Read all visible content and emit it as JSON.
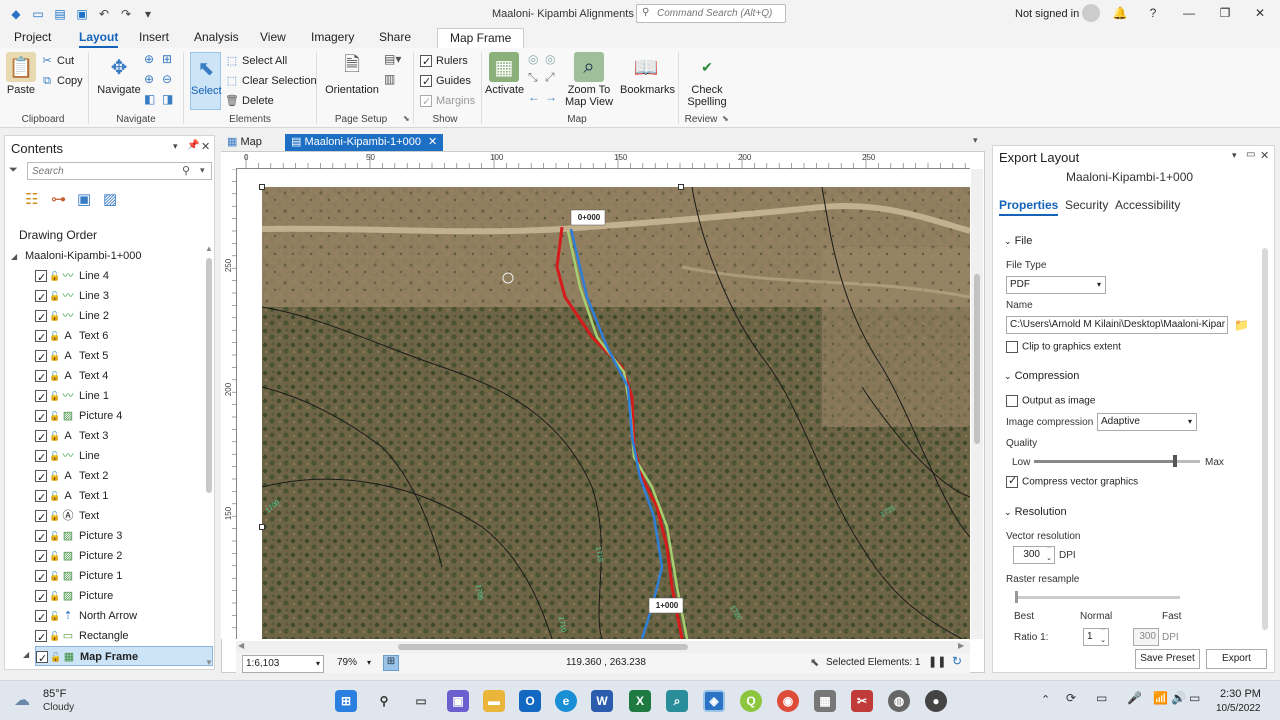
{
  "window": {
    "title": "Maaloni- Kipambi Alignments",
    "command_search_placeholder": "Command Search (Alt+Q)",
    "sign_in": "Not signed in"
  },
  "ribbon_tabs": [
    "Project",
    "Layout",
    "Insert",
    "Analysis",
    "View",
    "Imagery",
    "Share",
    "Map Frame"
  ],
  "ribbon": {
    "clipboard": {
      "paste": "Paste",
      "cut": "Cut",
      "copy": "Copy",
      "label": "Clipboard"
    },
    "navigate": {
      "navigate": "Navigate",
      "label": "Navigate"
    },
    "elements": {
      "select": "Select",
      "select_all": "Select All",
      "clear_selection": "Clear Selection",
      "delete": "Delete",
      "label": "Elements"
    },
    "page_setup": {
      "orientation": "Orientation",
      "label": "Page Setup"
    },
    "show": {
      "rulers": "Rulers",
      "guides": "Guides",
      "margins": "Margins",
      "label": "Show"
    },
    "map": {
      "activate": "Activate",
      "zoom_to_map_view": "Zoom To Map View",
      "bookmarks": "Bookmarks",
      "label": "Map"
    },
    "review": {
      "check_spelling": "Check Spelling",
      "label": "Review"
    }
  },
  "contents": {
    "title": "Contents",
    "search_placeholder": "Search",
    "drawing_order": "Drawing Order",
    "root": "Maaloni-Kipambi-1+000",
    "items": [
      {
        "label": "Line 4",
        "icon": "line-icon"
      },
      {
        "label": "Line 3",
        "icon": "line-icon"
      },
      {
        "label": "Line 2",
        "icon": "line-icon"
      },
      {
        "label": "Text 6",
        "icon": "text-icon"
      },
      {
        "label": "Text 5",
        "icon": "text-icon"
      },
      {
        "label": "Text 4",
        "icon": "text-icon"
      },
      {
        "label": "Line 1",
        "icon": "line-icon"
      },
      {
        "label": "Picture 4",
        "icon": "picture-icon"
      },
      {
        "label": "Text 3",
        "icon": "text-icon"
      },
      {
        "label": "Line",
        "icon": "line-icon"
      },
      {
        "label": "Text 2",
        "icon": "text-icon"
      },
      {
        "label": "Text 1",
        "icon": "text-icon"
      },
      {
        "label": "Text",
        "icon": "text-box-icon"
      },
      {
        "label": "Picture 3",
        "icon": "picture-icon"
      },
      {
        "label": "Picture 2",
        "icon": "picture-icon"
      },
      {
        "label": "Picture 1",
        "icon": "picture-icon"
      },
      {
        "label": "Picture",
        "icon": "picture-icon"
      },
      {
        "label": "North Arrow",
        "icon": "north-arrow-icon"
      },
      {
        "label": "Rectangle",
        "icon": "rectangle-icon"
      },
      {
        "label": "Map Frame",
        "icon": "map-frame-icon"
      }
    ]
  },
  "doc_tabs": {
    "map": "Map",
    "layout": "Maaloni-Kipambi-1+000"
  },
  "ruler": {
    "h": [
      "0",
      "50",
      "100",
      "150",
      "200",
      "250"
    ],
    "v": [
      "250",
      "200",
      "150"
    ]
  },
  "map": {
    "chainage_start": "0+000",
    "chainage_end": "1+000"
  },
  "status": {
    "scale": "1:6,103",
    "zoom": "79%",
    "coords": "119.360 , 263.238",
    "selected": "Selected Elements: 1"
  },
  "export": {
    "title": "Export Layout",
    "subtitle": "Maaloni-Kipambi-1+000",
    "tabs": [
      "Properties",
      "Security",
      "Accessibility"
    ],
    "file_section": "File",
    "file_type_label": "File Type",
    "file_type": "PDF",
    "name_label": "Name",
    "name_value": "C:\\Users\\Arnold M Kilaini\\Desktop\\Maaloni-Kipar",
    "clip": "Clip to graphics extent",
    "compression_section": "Compression",
    "output_as_image": "Output as image",
    "image_compression_label": "Image compression",
    "image_compression": "Adaptive",
    "quality_label": "Quality",
    "quality_low": "Low",
    "quality_high": "Max",
    "quality_value": 0.85,
    "compress_vector": "Compress vector graphics",
    "resolution_section": "Resolution",
    "vector_resolution_label": "Vector resolution",
    "vector_resolution": "300",
    "dpi": "DPI",
    "raster_resample_label": "Raster resample",
    "resample_best": "Best",
    "resample_normal": "Normal",
    "resample_fast": "Fast",
    "ratio_label": "Ratio 1:",
    "ratio_value": "1",
    "ratio_dpi": "300",
    "save_preset": "Save Preset",
    "export_btn": "Export"
  },
  "taskbar": {
    "temp": "85°F",
    "weather": "Cloudy",
    "time": "2:30 PM",
    "date": "10/5/2022"
  }
}
